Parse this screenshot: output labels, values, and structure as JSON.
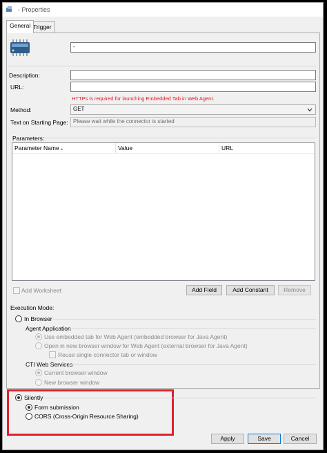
{
  "window": {
    "title": "- Properties"
  },
  "tabs": [
    {
      "label": "General"
    },
    {
      "label": "Trigger"
    }
  ],
  "general": {
    "name_value": "-",
    "description_label": "Description:",
    "description_value": "",
    "url_label": "URL:",
    "url_value": "",
    "url_warning": "HTTPs is required for launching Embedded Tab in Web Agent.",
    "method_label": "Method:",
    "method_value": "GET",
    "starting_page_label": "Text on Starting Page:",
    "starting_page_value": "Please wait while the connector is started",
    "parameters_label": "Parameters:",
    "parameters_columns": [
      "Parameter Name",
      "Value",
      "URL"
    ],
    "add_worksheet_label": "Add Worksheet",
    "add_field_label": "Add Field",
    "add_constant_label": "Add Constant",
    "remove_label": "Remove",
    "execution_mode_label": "Execution Mode:",
    "in_browser_label": "In Browser",
    "agent_application_label": "Agent Application",
    "use_embedded_label": "Use embedded tab for Web Agent (embedded browser for Java Agent)",
    "open_new_window_label": "Open in new browser window for Web Agent (external browser for Java Agent)",
    "reuse_single_label": "Reuse single connector tab or window",
    "cti_label": "CTI Web Services",
    "current_browser_label": "Current browser window",
    "new_browser_label": "New browser window",
    "silently_label": "Silently",
    "form_submission_label": "Form submission",
    "cors_label": "CORS (Cross-Origin Resource Sharing)"
  },
  "footer": {
    "apply_label": "Apply",
    "save_label": "Save",
    "cancel_label": "Cancel"
  },
  "colors": {
    "highlight": "#e0202a",
    "warning": "#e81123",
    "focus": "#0078d7"
  }
}
